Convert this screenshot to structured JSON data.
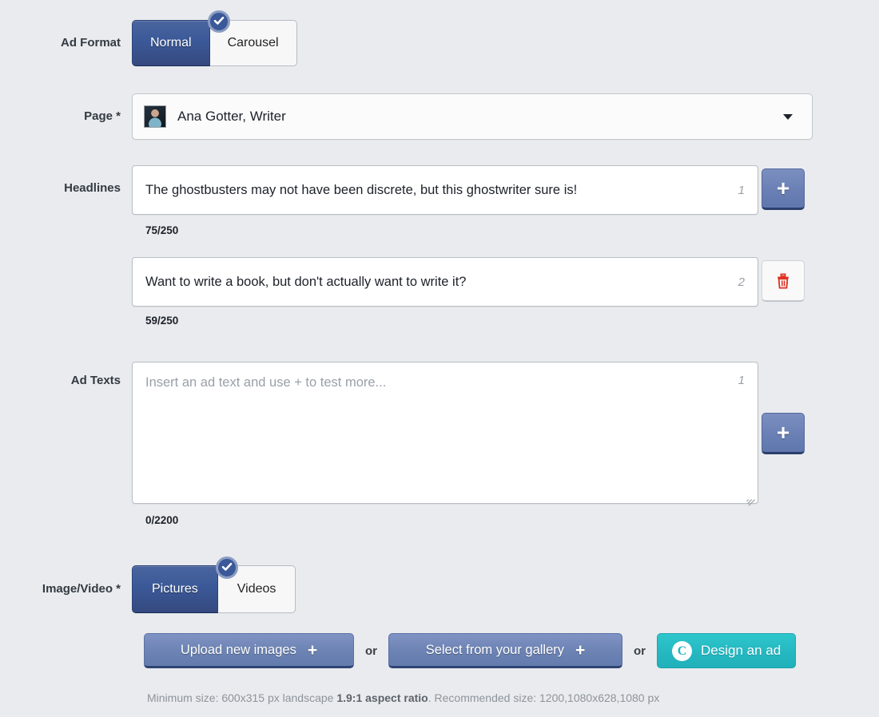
{
  "theme": {
    "page_bg": "#e9ebee",
    "primary_blue": "#3b5998",
    "button_blue": "#6d84b4",
    "canva_teal": "#25b8c1",
    "delete_red": "#e0301e"
  },
  "ad_format": {
    "label": "Ad Format",
    "options": [
      "Normal",
      "Carousel"
    ],
    "selected": "Normal",
    "check_icon": "check-icon"
  },
  "page": {
    "label": "Page *",
    "selected": "Ana Gotter, Writer",
    "avatar_icon": "avatar-photo",
    "caret_icon": "chevron-down-icon"
  },
  "headlines": {
    "label": "Headlines",
    "items": [
      {
        "value": "The ghostbusters may not have been discrete, but this ghostwriter sure is!",
        "index": "1",
        "counter": "75/250",
        "action": "add",
        "action_label": "+"
      },
      {
        "value": "Want to write a book, but don't actually want to write it?",
        "index": "2",
        "counter": "59/250",
        "action": "delete",
        "action_label": "trash-icon"
      }
    ]
  },
  "ad_texts": {
    "label": "Ad Texts",
    "placeholder": "Insert an ad text and use + to test more...",
    "value": "",
    "index": "1",
    "counter": "0/2200",
    "add_label": "+"
  },
  "image_video": {
    "label": "Image/Video *",
    "options": [
      "Pictures",
      "Videos"
    ],
    "selected": "Pictures",
    "check_icon": "check-icon",
    "actions": {
      "upload_label": "Upload new images",
      "upload_glyph": "+",
      "or_1": "or",
      "gallery_label": "Select from your gallery",
      "gallery_glyph": "+",
      "or_2": "or",
      "design_label": "Design an ad",
      "design_logo": "C"
    },
    "hint_prefix": "Minimum size: 600x315 px landscape ",
    "hint_bold": "1.9:1 aspect ratio",
    "hint_suffix": ". Recommended size: 1200,1080x628,1080 px"
  }
}
